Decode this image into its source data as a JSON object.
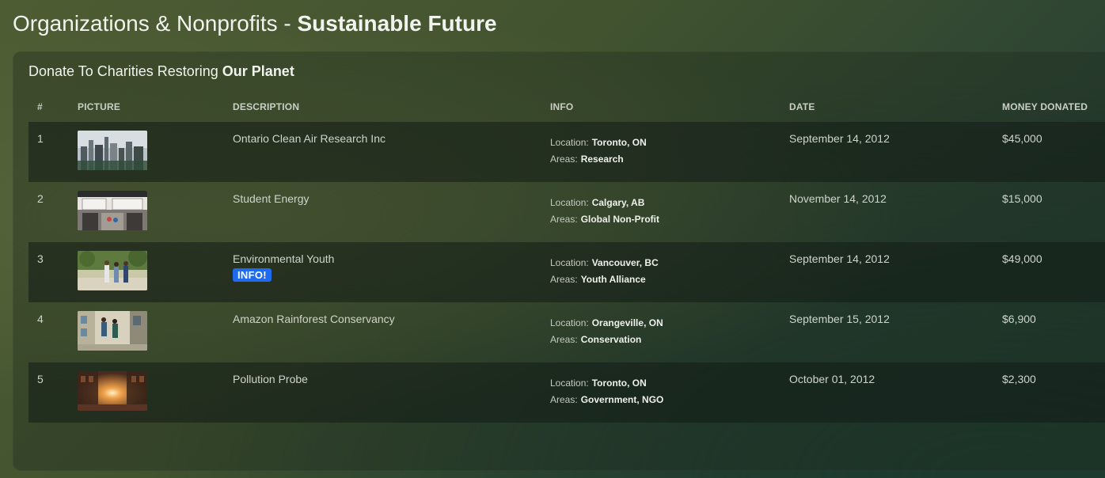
{
  "header": {
    "title_light": "Organizations & Nonprofits - ",
    "title_bold": "Sustainable Future"
  },
  "panel": {
    "title_light": "Donate To Charities Restoring ",
    "title_bold": "Our Planet"
  },
  "table": {
    "columns": [
      "#",
      "PICTURE",
      "DESCRIPTION",
      "INFO",
      "DATE",
      "MONEY DONATED"
    ],
    "info_labels": {
      "location": "Location:",
      "areas": "Areas:"
    },
    "rows": [
      {
        "num": "1",
        "picture": "city-skyline-photo",
        "description": "Ontario Clean Air Research Inc",
        "badge": "",
        "location": "Toronto, ON",
        "areas": "Research",
        "date": "September 14, 2012",
        "money": "$45,000"
      },
      {
        "num": "2",
        "picture": "storefront-photo",
        "description": "Student Energy",
        "badge": "",
        "location": "Calgary, AB",
        "areas": "Global Non-Profit",
        "date": "November 14, 2012",
        "money": "$15,000"
      },
      {
        "num": "3",
        "picture": "people-walking-photo",
        "description": "Environmental Youth",
        "badge": "INFO!",
        "location": "Vancouver, BC",
        "areas": "Youth Alliance",
        "date": "September 14, 2012",
        "money": "$49,000"
      },
      {
        "num": "4",
        "picture": "street-jump-photo",
        "description": "Amazon Rainforest Conservancy",
        "badge": "",
        "location": "Orangeville, ON",
        "areas": "Conservation",
        "date": "September 15, 2012",
        "money": "$6,900"
      },
      {
        "num": "5",
        "picture": "sunset-street-photo",
        "description": "Pollution Probe",
        "badge": "",
        "location": "Toronto, ON",
        "areas": "Government, NGO",
        "date": "October 01, 2012",
        "money": "$2,300"
      }
    ]
  },
  "colors": {
    "badge": "#1f6bf0",
    "accent_text": "#f1f3ee"
  }
}
